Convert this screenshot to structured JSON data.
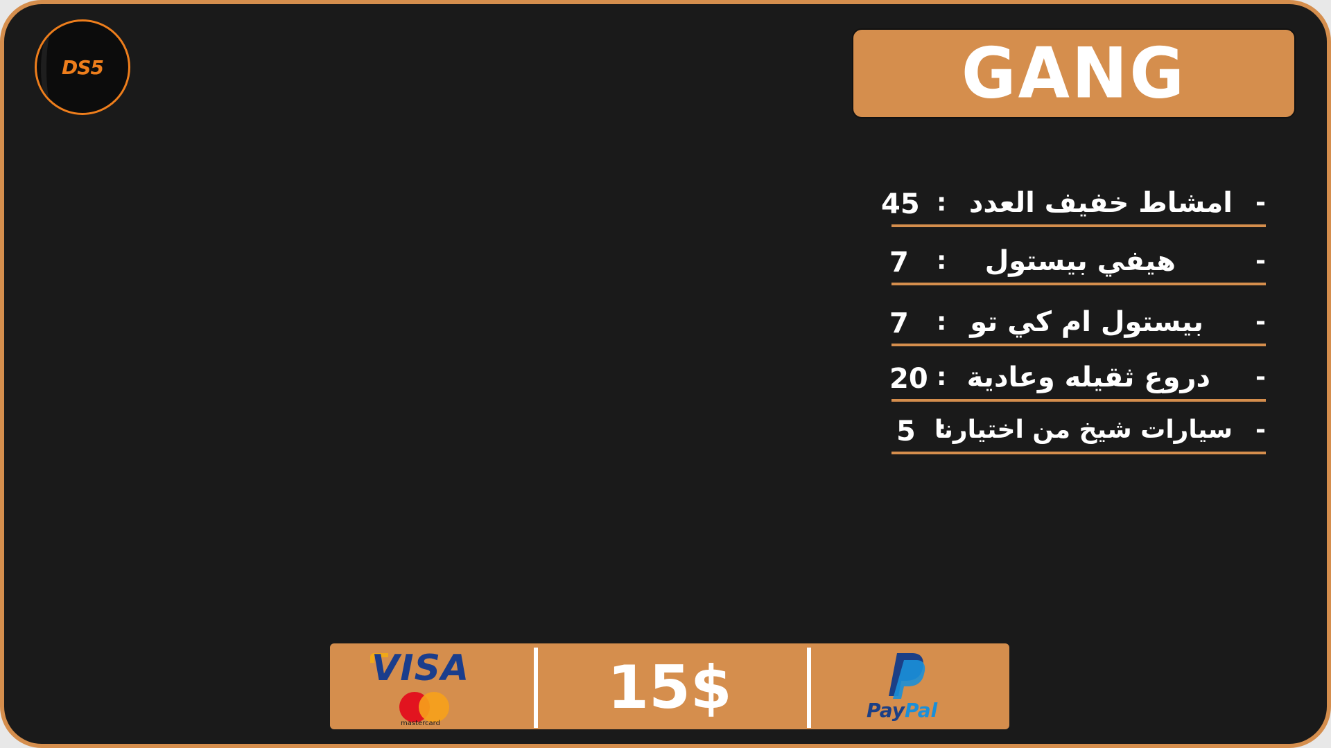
{
  "logo": {
    "text": "DS5",
    "icon": "ds5-logo-icon"
  },
  "title": "GANG",
  "items": [
    {
      "dash": "-",
      "label": "امشاط خفيف العدد",
      "colon": ":",
      "value": "45"
    },
    {
      "dash": "-",
      "label": "هيفي بيستول",
      "colon": ":",
      "value": "7"
    },
    {
      "dash": "-",
      "label": "بيستول ام كي تو",
      "colon": ":",
      "value": "7"
    },
    {
      "dash": "-",
      "label": "دروع ثقيله وعادية",
      "colon": ":",
      "value": "20"
    },
    {
      "dash": "-",
      "label": "سيارات شيخ من اختيارنا",
      "colon": ":",
      "value": "5"
    }
  ],
  "payment": {
    "visa_text": "VISA",
    "mastercard_text": "mastercard",
    "price": "15$",
    "paypal_pay": "Pay",
    "paypal_pal": "Pal"
  },
  "colors": {
    "accent": "#d58e4d",
    "background": "#1a1a1a",
    "logo_orange": "#ee7e1c",
    "text": "#ffffff"
  }
}
